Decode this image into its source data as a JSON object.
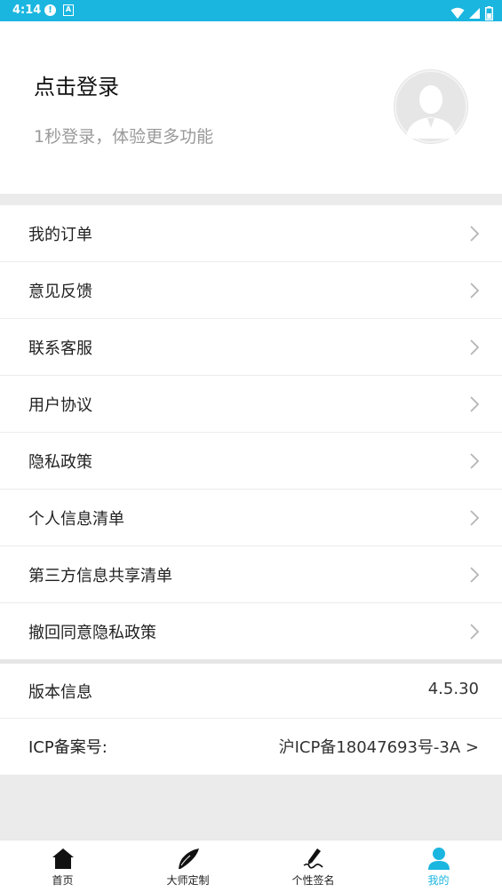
{
  "status_bar": {
    "time": "4:14",
    "alert_glyph": "!",
    "a_glyph": "A",
    "background": "#1ab6e0",
    "icons": [
      "alert-icon",
      "a-icon",
      "wifi-icon",
      "signal-icon",
      "battery-icon"
    ]
  },
  "profile": {
    "title": "点击登录",
    "subtitle": "1秒登录，体验更多功能",
    "avatar_icon": "default-user-avatar-icon"
  },
  "menu": {
    "items": [
      {
        "label": "我的订单"
      },
      {
        "label": "意见反馈"
      },
      {
        "label": "联系客服"
      },
      {
        "label": "用户协议"
      },
      {
        "label": "隐私政策"
      },
      {
        "label": "个人信息清单"
      },
      {
        "label": "第三方信息共享清单"
      },
      {
        "label": "撤回同意隐私政策"
      }
    ]
  },
  "info": {
    "version_label": "版本信息",
    "version_value": "4.5.30",
    "icp_label": "ICP备案号:",
    "icp_value": "沪ICP备18047693号-3A >"
  },
  "tabbar": {
    "active_color": "#1ab6e0",
    "tabs": [
      {
        "label": "首页",
        "icon": "home-icon"
      },
      {
        "label": "大师定制",
        "icon": "brush-icon"
      },
      {
        "label": "个性签名",
        "icon": "pen-icon"
      },
      {
        "label": "我的",
        "icon": "person-icon"
      }
    ]
  }
}
